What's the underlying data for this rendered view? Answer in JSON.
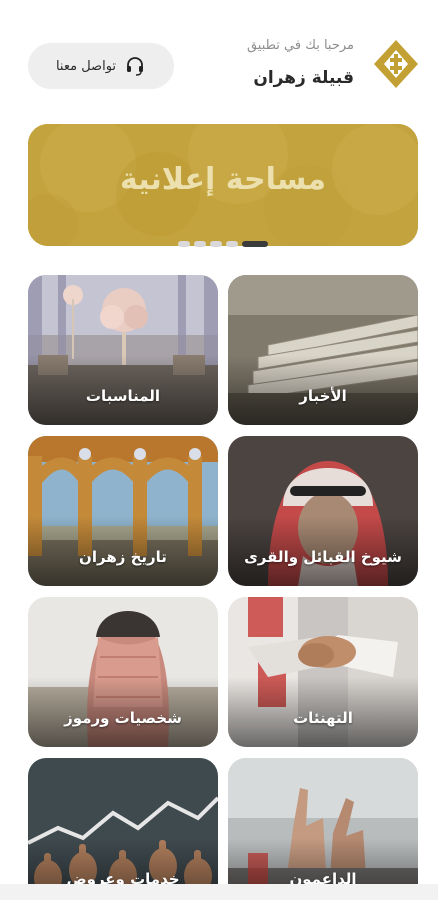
{
  "header": {
    "welcome_text": "مرحبا بك في تطبيق",
    "app_name": "قبيلة زهران",
    "contact_label": "تواصل معنا",
    "logo_icon": "zahran-logo-icon",
    "contact_icon": "headset-icon"
  },
  "banner": {
    "text": "مساحة إعلانية",
    "color": "#c3a33d",
    "slides_count": 5,
    "active_slide": 5
  },
  "tiles": [
    {
      "label": "الأخبار",
      "icon": "newspaper-image"
    },
    {
      "label": "المناسبات",
      "icon": "wedding-hall-image"
    },
    {
      "label": "شيوخ القبائل والقرى",
      "icon": "sheikh-portrait-image"
    },
    {
      "label": "تاريخ زهران",
      "icon": "heritage-arches-image"
    },
    {
      "label": "التهنئات",
      "icon": "handshake-image"
    },
    {
      "label": "شخصيات ورموز",
      "icon": "man-in-shemagh-image"
    },
    {
      "label": "الداعمون",
      "icon": "raised-hands-image"
    },
    {
      "label": "خدمات وعروض",
      "icon": "thumbs-up-crowd-image"
    }
  ]
}
